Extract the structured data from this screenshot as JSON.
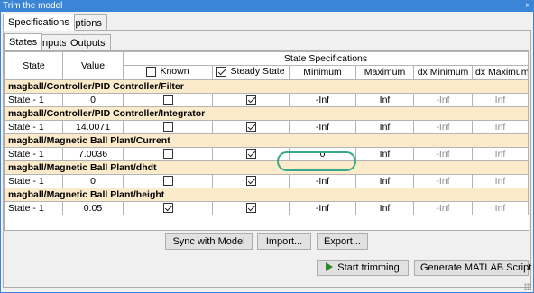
{
  "window": {
    "title": "Trim the model",
    "close_glyph": "×"
  },
  "outer_tabs": [
    {
      "label": "Specifications",
      "active": true
    },
    {
      "label": "Options",
      "active": false
    }
  ],
  "inner_tabs": [
    {
      "label": "States",
      "active": true
    },
    {
      "label": "Inputs",
      "active": false
    },
    {
      "label": "Outputs",
      "active": false
    }
  ],
  "table": {
    "headers": {
      "state": "State",
      "value": "Value",
      "group": "State Specifications",
      "known": "Known",
      "steady_state": "Steady State",
      "minimum": "Minimum",
      "maximum": "Maximum",
      "dx_minimum": "dx Minimum",
      "dx_maximum": "dx Maximum"
    },
    "groups": [
      {
        "name": "magball/Controller/PID Controller/Filter",
        "row": {
          "state": "State - 1",
          "value": "0",
          "known": false,
          "steady": true,
          "min": "-Inf",
          "max": "Inf",
          "dxmin": "-Inf",
          "dxmax": "Inf"
        }
      },
      {
        "name": "magball/Controller/PID Controller/Integrator",
        "row": {
          "state": "State - 1",
          "value": "14.0071",
          "known": false,
          "steady": true,
          "min": "-Inf",
          "max": "Inf",
          "dxmin": "-Inf",
          "dxmax": "Inf"
        }
      },
      {
        "name": "magball/Magnetic Ball Plant/Current",
        "row": {
          "state": "State - 1",
          "value": "7.0036",
          "known": false,
          "steady": true,
          "min": "0",
          "max": "Inf",
          "dxmin": "-Inf",
          "dxmax": "Inf"
        }
      },
      {
        "name": "magball/Magnetic Ball Plant/dhdt",
        "row": {
          "state": "State - 1",
          "value": "0",
          "known": false,
          "steady": true,
          "min": "-Inf",
          "max": "Inf",
          "dxmin": "-Inf",
          "dxmax": "Inf"
        }
      },
      {
        "name": "magball/Magnetic Ball Plant/height",
        "row": {
          "state": "State - 1",
          "value": "0.05",
          "known": true,
          "steady": true,
          "min": "-Inf",
          "max": "Inf",
          "dxmin": "-Inf",
          "dxmax": "Inf"
        }
      }
    ]
  },
  "buttons": {
    "sync": "Sync with Model",
    "import": "Import...",
    "export": "Export...",
    "start_trimming": "Start trimming",
    "generate_script": "Generate MATLAB Script"
  },
  "colors": {
    "titlebar": "#3a85d5",
    "group_row": "#fbebcb",
    "highlight_ring": "#38a88a",
    "play_icon": "#2a8a2a"
  },
  "icons": [
    "close-icon",
    "checkbox-icon",
    "play-icon",
    "resize-grip-icon"
  ]
}
